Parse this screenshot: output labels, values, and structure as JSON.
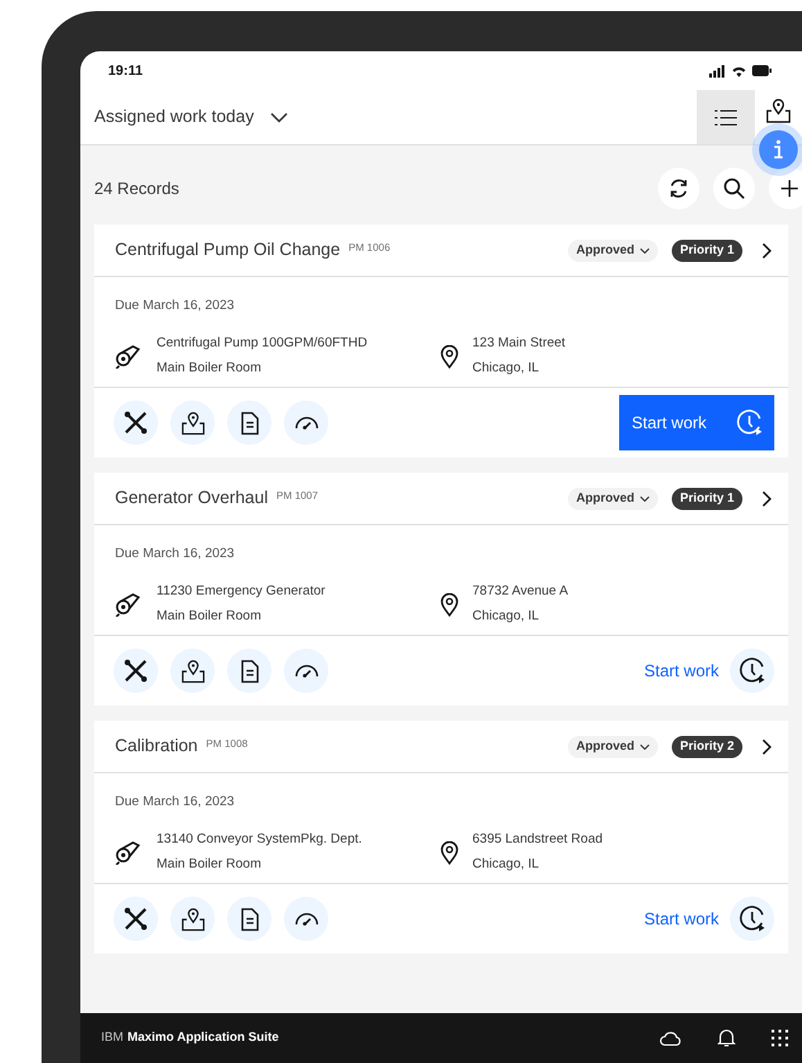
{
  "status_bar": {
    "time": "19:11"
  },
  "header": {
    "view_title": "Assigned work today",
    "views": [
      {
        "kind": "list",
        "selected": true
      },
      {
        "kind": "map",
        "selected": false
      }
    ]
  },
  "toolbar": {
    "record_count": "24 Records"
  },
  "work_orders": [
    {
      "title": "Centrifugal Pump Oil Change",
      "code": "PM 1006",
      "status": "Approved",
      "priority": "Priority 1",
      "due": "Due March 16, 2023",
      "asset": "Centrifugal Pump 100GPM/60FTHD",
      "asset_location": "Main Boiler Room",
      "address": "123 Main Street",
      "city": "Chicago, IL",
      "start_label": "Start work",
      "start_primary": true
    },
    {
      "title": "Generator Overhaul",
      "code": "PM 1007",
      "status": "Approved",
      "priority": "Priority 1",
      "due": "Due March 16, 2023",
      "asset": "11230 Emergency Generator",
      "asset_location": "Main Boiler Room",
      "address": "78732 Avenue A",
      "city": "Chicago, IL",
      "start_label": "Start work",
      "start_primary": false
    },
    {
      "title": "Calibration",
      "code": "PM 1008",
      "status": "Approved",
      "priority": "Priority 2",
      "due": "Due March 16, 2023",
      "asset": "13140 Conveyor SystemPkg. Dept.",
      "asset_location": "Main Boiler Room",
      "address": "6395 Landstreet Road",
      "city": "Chicago, IL",
      "start_label": "Start work",
      "start_primary": false
    }
  ],
  "footer": {
    "brand_prefix": "IBM",
    "product": "Maximo Application Suite"
  }
}
